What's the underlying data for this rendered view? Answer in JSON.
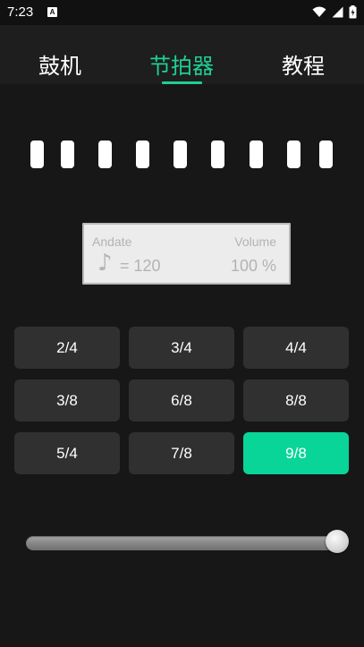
{
  "status_bar": {
    "time": "7:23",
    "notification_icon": "A"
  },
  "tabs": [
    {
      "label": "鼓机",
      "active": false
    },
    {
      "label": "节拍器",
      "active": true
    },
    {
      "label": "教程",
      "active": false
    }
  ],
  "beats": {
    "count": 9
  },
  "display": {
    "tempo_name": "Andate",
    "volume_label": "Volume",
    "note_symbol": "♪",
    "bpm_text": "= 120",
    "volume_text": "100 %"
  },
  "signatures": [
    {
      "label": "2/4",
      "selected": false
    },
    {
      "label": "3/4",
      "selected": false
    },
    {
      "label": "4/4",
      "selected": false
    },
    {
      "label": "3/8",
      "selected": false
    },
    {
      "label": "6/8",
      "selected": false
    },
    {
      "label": "8/8",
      "selected": false
    },
    {
      "label": "5/4",
      "selected": false
    },
    {
      "label": "7/8",
      "selected": false
    },
    {
      "label": "9/8",
      "selected": true
    }
  ],
  "slider": {
    "value_fraction": 1.0
  },
  "colors": {
    "accent": "#1fcf91",
    "selected_button": "#09d598",
    "button": "#303030",
    "background": "#171717"
  }
}
